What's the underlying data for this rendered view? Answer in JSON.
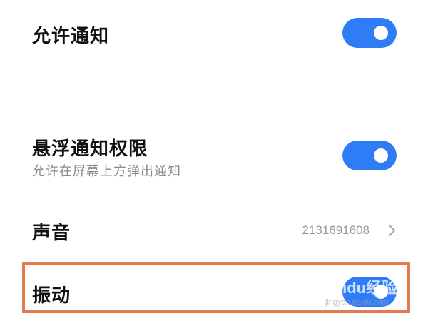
{
  "settings": {
    "allow_notifications": {
      "label": "允许通知",
      "enabled": true
    },
    "floating_notifications": {
      "label": "悬浮通知权限",
      "description": "允许在屏幕上方弹出通知",
      "enabled": true
    },
    "sound": {
      "label": "声音",
      "value": "2131691608",
      "icon": "chevron-right-icon"
    },
    "vibration": {
      "label": "振动",
      "enabled": true
    }
  },
  "annotation": {
    "highlight_color": "#e8784f",
    "highlighted_item": "vibration"
  },
  "watermark": {
    "text": "Baidu经验",
    "url": "jingyan.baidu.com"
  },
  "colors": {
    "toggle_on": "#2f7df6"
  }
}
